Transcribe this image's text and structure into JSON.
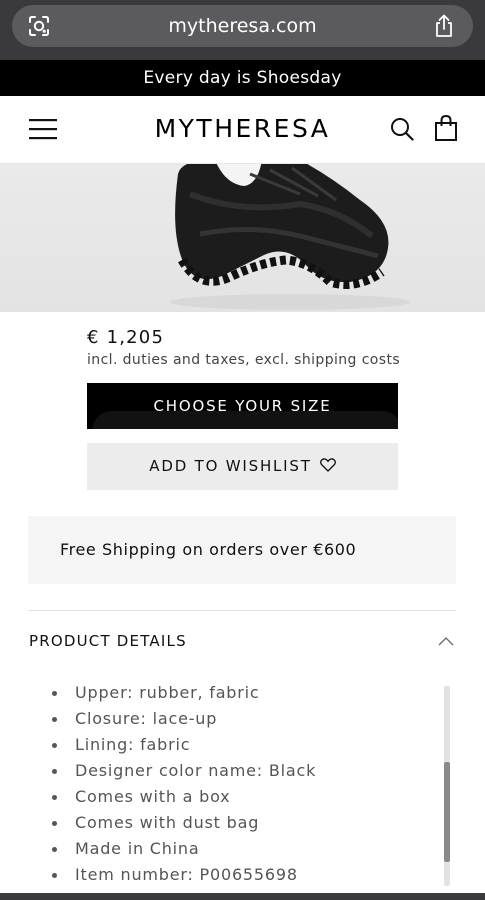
{
  "browser": {
    "url": "mytheresa.com",
    "left_icon": "lens-icon",
    "right_icon": "share-icon"
  },
  "promo": {
    "text": "Every day is Shoesday"
  },
  "header": {
    "logo": "MYTHERESA",
    "icons": [
      "menu-icon",
      "search-icon",
      "bag-icon"
    ]
  },
  "product": {
    "price": "€ 1,205",
    "price_note": "incl. duties and taxes, excl. shipping costs",
    "choose_size_label": "CHOOSE YOUR SIZE",
    "wishlist_label": "ADD TO WISHLIST"
  },
  "shipping": {
    "text": "Free Shipping on orders over €600"
  },
  "details": {
    "title": "PRODUCT DETAILS",
    "items": [
      "Upper: rubber, fabric",
      "Closure: lace-up",
      "Lining: fabric",
      "Designer color name: Black",
      "Comes with a box",
      "Comes with dust bag",
      "Made in China",
      "Item number: P00655698"
    ]
  },
  "colors": {
    "browser_chrome": "#3a3a3c",
    "promo_bg": "#000000",
    "primary_button": "#000000",
    "secondary_button": "#ececec",
    "shipping_bg": "#f5f5f5"
  }
}
